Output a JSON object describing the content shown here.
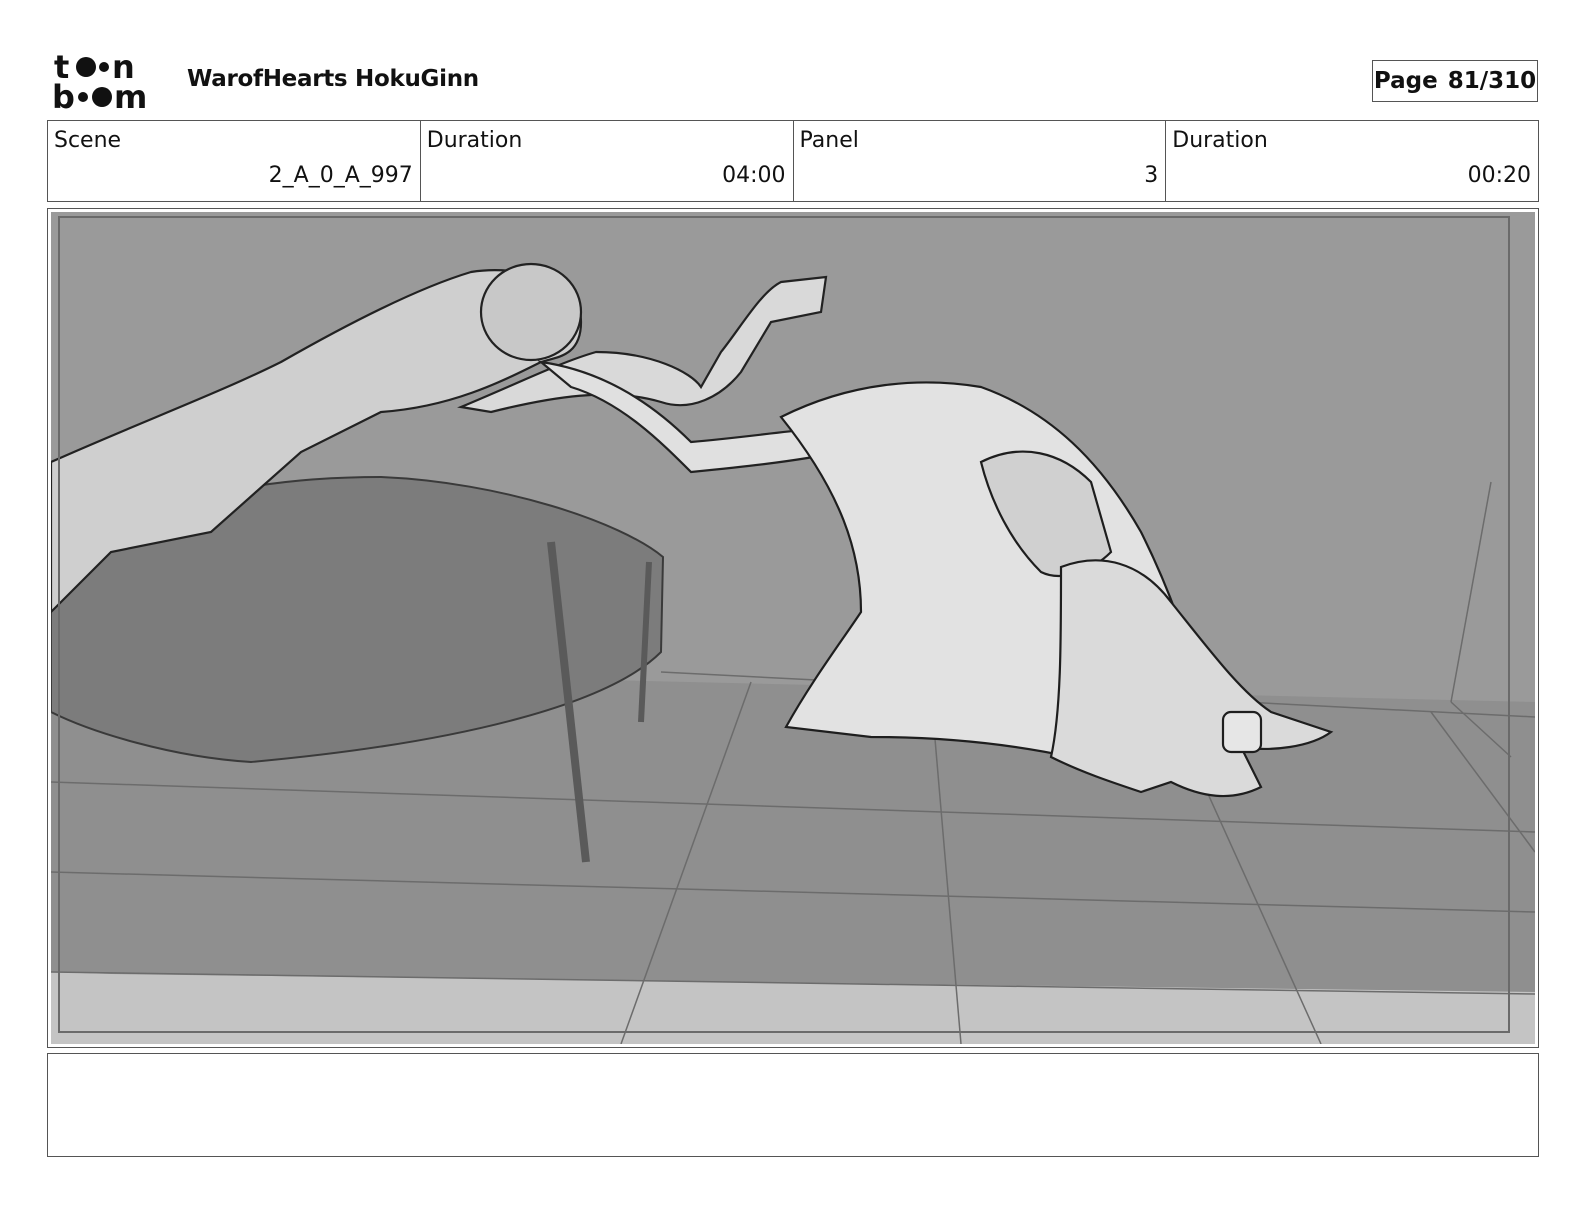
{
  "header": {
    "logo_text": "toon boom",
    "project_title": "WarofHearts HokuGinn",
    "page_label": "Page",
    "page_number": "81/310"
  },
  "info": {
    "scene_label": "Scene",
    "scene_value": "2_A_0_A_997",
    "scene_duration_label": "Duration",
    "scene_duration_value": "04:00",
    "panel_label": "Panel",
    "panel_value": "3",
    "panel_duration_label": "Duration",
    "panel_duration_value": "00:20"
  },
  "colors": {
    "wall": "#9a9a9a",
    "floor": "#8c8c8c",
    "bed": "#7e7e7e",
    "figure_fill": "#d6d6d6",
    "border": "#555555"
  },
  "notes": {
    "text": ""
  }
}
